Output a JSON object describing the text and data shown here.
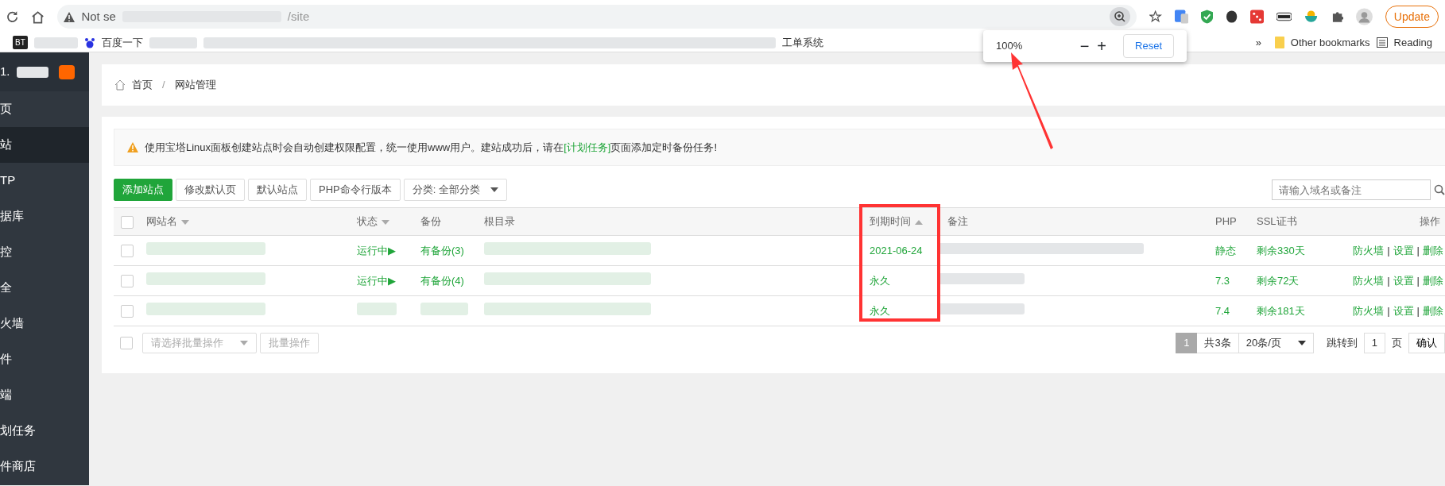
{
  "browser": {
    "security_label": "Not se",
    "url_tail": "/site",
    "update_button": "Update"
  },
  "bookmarks": {
    "bt_icon_text": "BT",
    "items": [
      {
        "kind": "baidu",
        "label": "百度一下"
      },
      {
        "kind": "plain",
        "label": "工单系统"
      }
    ],
    "overflow": "»",
    "other": "Other bookmarks",
    "reading": "Reading"
  },
  "zoom_popup": {
    "level_text": "100%",
    "zoom_out": "−",
    "zoom_in": "+",
    "reset": "Reset"
  },
  "sidebar": {
    "header": "1.",
    "items": [
      {
        "label": "页",
        "selected": false
      },
      {
        "label": "站",
        "selected": true
      },
      {
        "label": "TP",
        "selected": false
      },
      {
        "label": "据库",
        "selected": false
      },
      {
        "label": "控",
        "selected": false
      },
      {
        "label": "全",
        "selected": false
      },
      {
        "label": "火墙",
        "selected": false
      },
      {
        "label": "件",
        "selected": false
      },
      {
        "label": "端",
        "selected": false
      },
      {
        "label": "划任务",
        "selected": false
      },
      {
        "label": "件商店",
        "selected": false
      }
    ]
  },
  "breadcrumb": {
    "items": [
      "首页",
      "网站管理"
    ],
    "separator": "/"
  },
  "alert": {
    "text": "使用宝塔Linux面板创建站点时会自动创建权限配置，统一使用www用户。建站成功后，请在",
    "link": "[计划任务]",
    "text_after": "页面添加定时备份任务!"
  },
  "toolbar_buttons": [
    {
      "label": "添加站点",
      "kind": "primary"
    },
    {
      "label": "修改默认页",
      "kind": "default"
    },
    {
      "label": "默认站点",
      "kind": "default"
    },
    {
      "label": "PHP命令行版本",
      "kind": "default"
    },
    {
      "label": "分类: 全部分类",
      "kind": "dropdown"
    }
  ],
  "search": {
    "placeholder": "请输入域名或备注"
  },
  "table": {
    "select_all_checked": false,
    "columns": [
      {
        "label": "网站名",
        "sort_ascending": false
      },
      {
        "label": "状态",
        "sort_ascending": false
      },
      {
        "label": "备份"
      },
      {
        "label": "根目录"
      },
      {
        "label": "到期时间",
        "sort_ascending": true
      },
      {
        "label": "备注"
      },
      {
        "label": "PHP"
      },
      {
        "label": "SSL证书"
      },
      {
        "label": "操作"
      }
    ],
    "rows": [
      {
        "checked": false,
        "status": "运行中▶",
        "backup": "有备份(3)",
        "expiry": "2021-06-24",
        "php": "静态",
        "ssl": "剩余330天",
        "actions": [
          {
            "kind": "link",
            "label": "防火墙"
          },
          {
            "kind": "separator",
            "label": "|"
          },
          {
            "kind": "link",
            "label": "设置"
          },
          {
            "kind": "separator",
            "label": "|"
          },
          {
            "kind": "link",
            "label": "删除"
          }
        ]
      },
      {
        "checked": false,
        "status": "运行中▶",
        "backup": "有备份(4)",
        "expiry": "永久",
        "php": "7.3",
        "ssl": "剩余72天",
        "actions": [
          {
            "kind": "link",
            "label": "防火墙"
          },
          {
            "kind": "separator",
            "label": "|"
          },
          {
            "kind": "link",
            "label": "设置"
          },
          {
            "kind": "separator",
            "label": "|"
          },
          {
            "kind": "link",
            "label": "删除"
          }
        ]
      },
      {
        "checked": false,
        "expiry": "永久",
        "php": "7.4",
        "ssl": "剩余181天",
        "actions": [
          {
            "kind": "link",
            "label": "防火墙"
          },
          {
            "kind": "separator",
            "label": "|"
          },
          {
            "kind": "link",
            "label": "设置"
          },
          {
            "kind": "separator",
            "label": "|"
          },
          {
            "kind": "link",
            "label": "删除"
          }
        ]
      }
    ]
  },
  "batch": {
    "checked": false,
    "select_placeholder": "请选择批量操作",
    "button": "批量操作"
  },
  "pagination": {
    "pages": [
      {
        "label": "1",
        "selected": true
      }
    ],
    "total": "共3条",
    "page_size": "20条/页",
    "jump_label": "跳转到",
    "jump_value": "1",
    "page_unit": "页",
    "confirm": "确认"
  }
}
